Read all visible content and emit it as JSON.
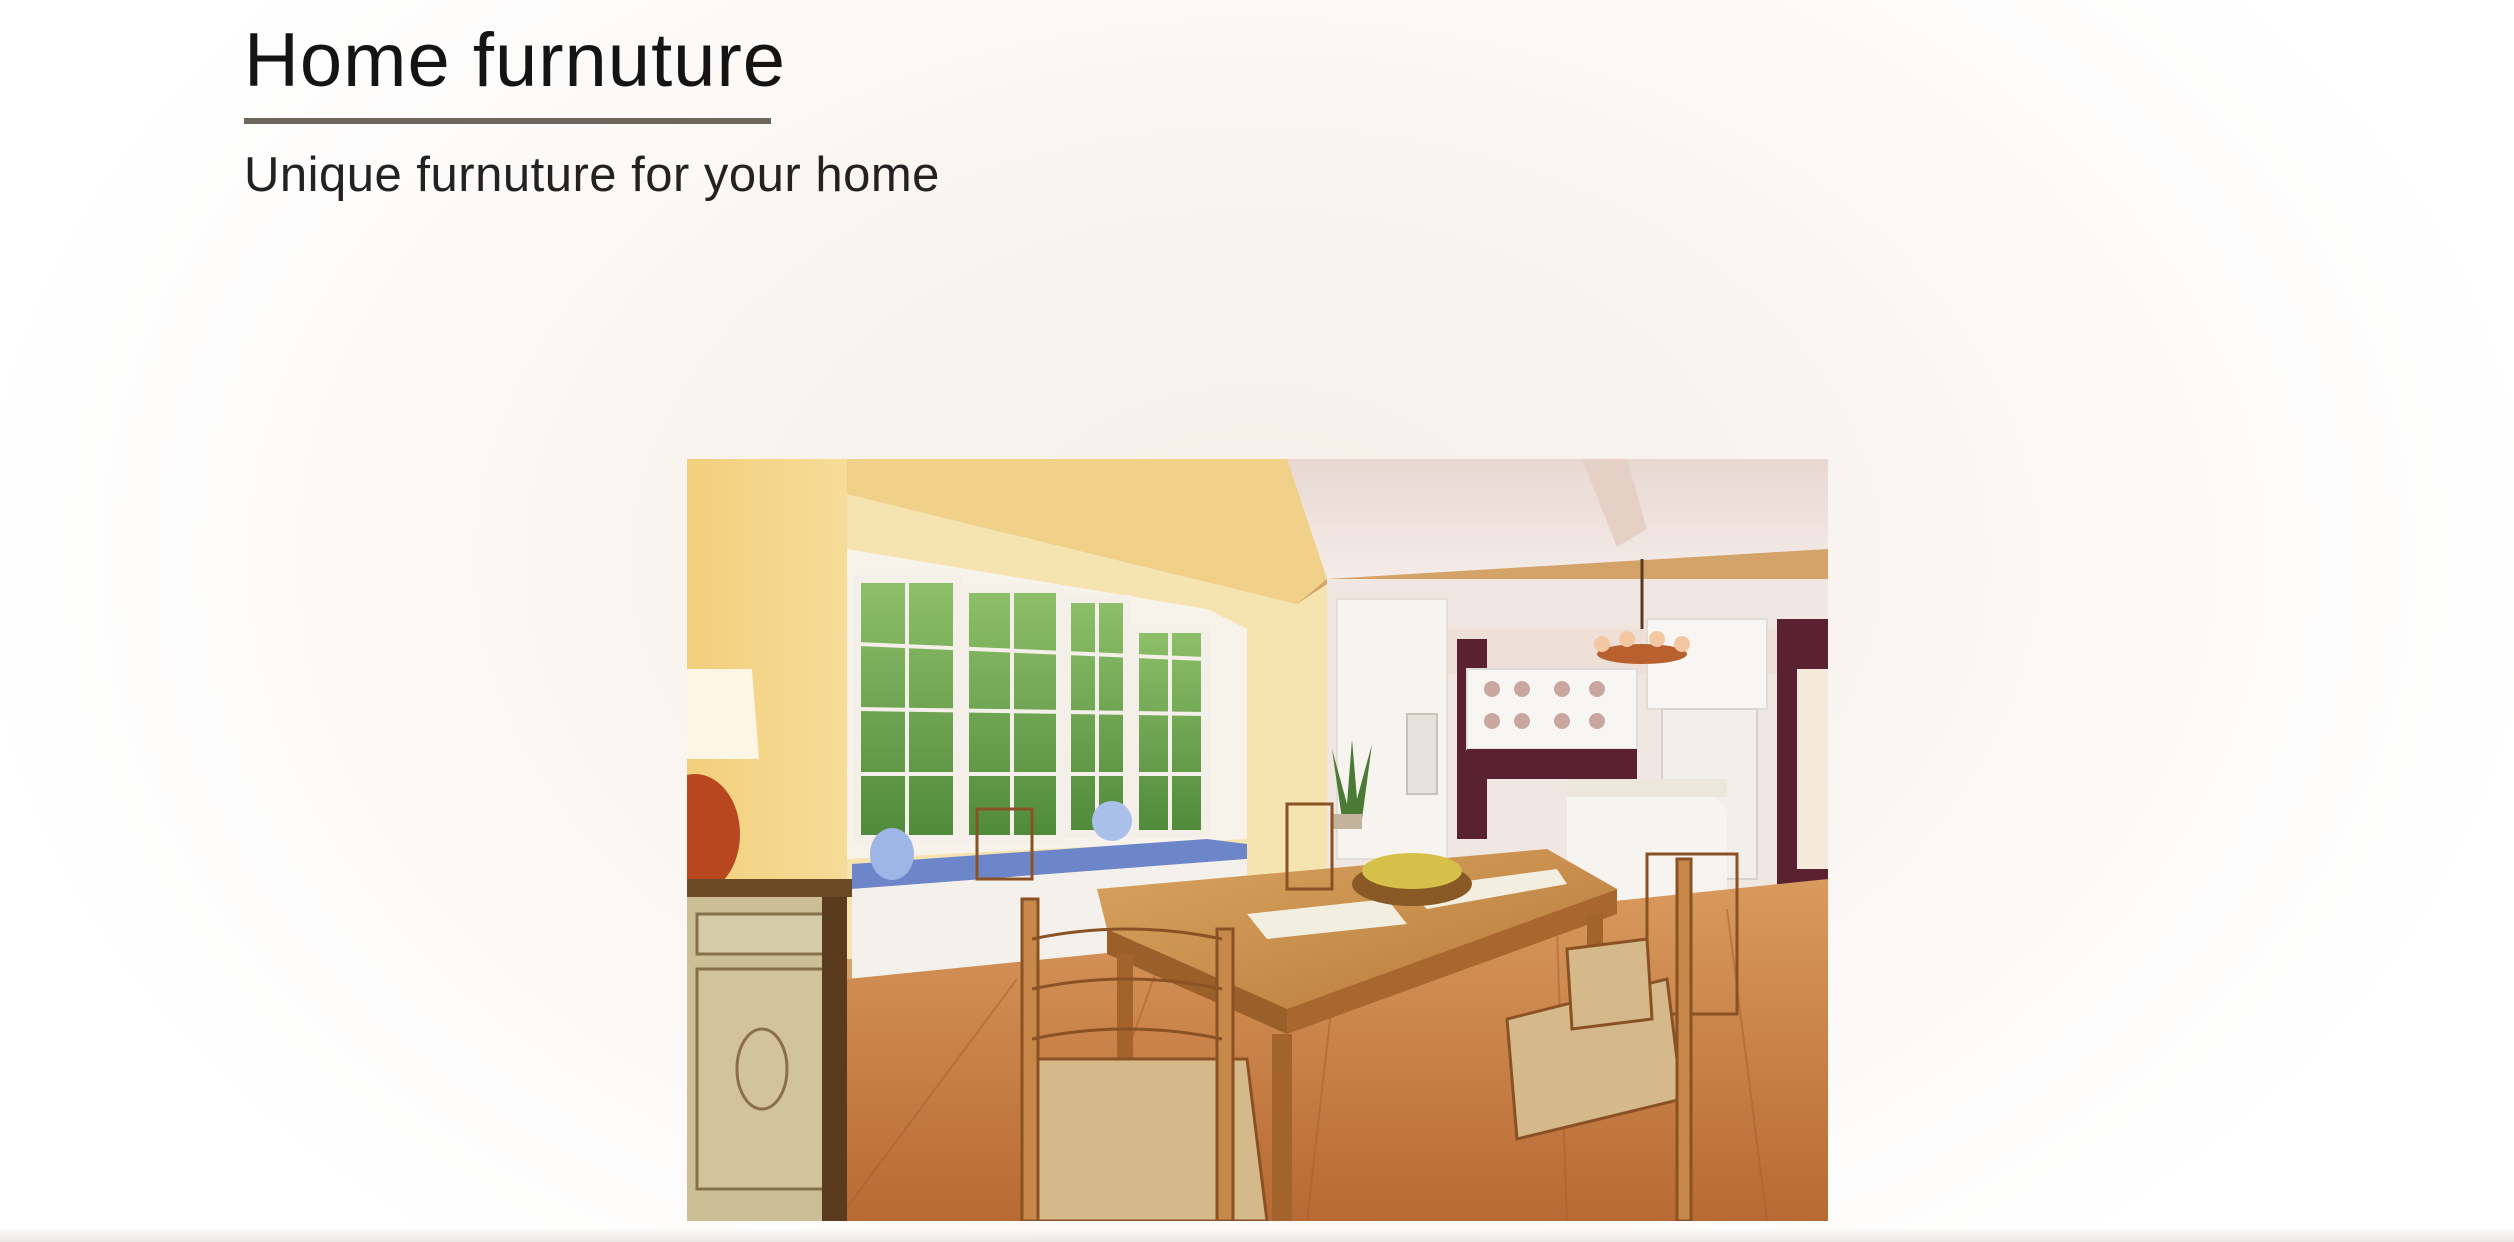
{
  "header": {
    "title": "Home furnuture",
    "subtitle": "Unique furnuture for your home"
  },
  "hero": {
    "image_icon": "dining-room-photo"
  },
  "colors": {
    "rule": "#6d675c",
    "title_text": "#141414",
    "background": "#f6f1ec"
  }
}
